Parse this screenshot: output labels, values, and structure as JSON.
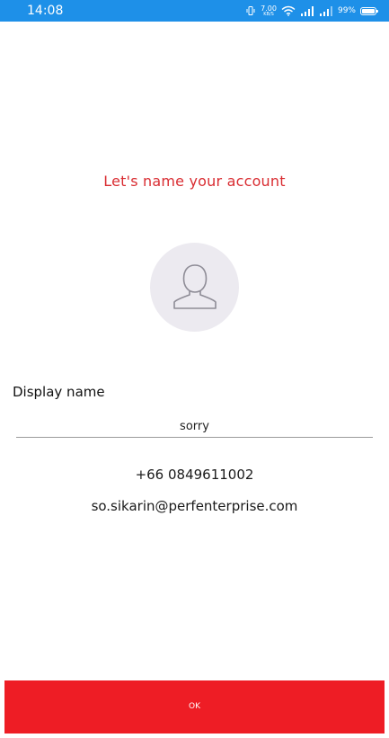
{
  "status_bar": {
    "time": "14:08",
    "net_speed_value": "7.00",
    "net_speed_unit": "KB/S",
    "battery_percent": "99%",
    "background_color": "#1e90e8"
  },
  "page": {
    "title": "Let's name your account",
    "title_color": "#d92d32"
  },
  "avatar": {
    "icon": "person-outline-icon",
    "background_color": "#eceaf0"
  },
  "form": {
    "display_name_label": "Display name",
    "display_name_value": "sorry"
  },
  "account": {
    "phone": "+66 0849611002",
    "email": "so.sikarin@perfenterprise.com"
  },
  "actions": {
    "ok_label": "OK",
    "ok_color": "#ee1d25"
  }
}
